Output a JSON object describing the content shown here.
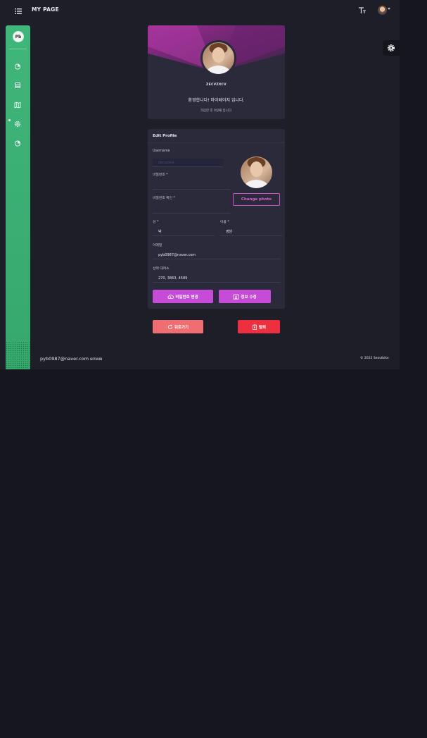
{
  "header": {
    "title": "MY PAGE"
  },
  "sidebar": {
    "logo_text": "Pb"
  },
  "profile": {
    "name": "ZECVZXCV",
    "welcome": "환영합니다! 마이페이지 입니다.",
    "joined": "가입한 후 0일째 입니다."
  },
  "edit_profile": {
    "title": "Edit Profile",
    "username_label": "Username",
    "username_placeholder": "zecvzxcv",
    "password_label": "비밀번호 *",
    "password_confirm_label": "비밀번호 확인 *",
    "change_photo": "Change photo",
    "last_name_label": "성 *",
    "last_name_value": "박",
    "first_name_label": "이름 *",
    "first_name_value": "영빈",
    "email_label": "이메일",
    "email_value": "pyb0987@naver.com",
    "station_label": "선택 대여소",
    "station_value": "270, 3863, 4589",
    "change_password_button": "비밀번호 변경",
    "update_info_button": "정보 수정"
  },
  "actions": {
    "back_button": "뒤로가기",
    "withdraw_button": "탈퇴"
  },
  "footer": {
    "email": "pyb0987@naver.com",
    "github": "GITHUB",
    "copyright": "© 2022 Seoulbike"
  },
  "colors": {
    "sidebar_green": "#3fb67a",
    "accent_magenta": "#c64bd6",
    "back_pink": "#f06e72",
    "withdraw_red": "#ee2f3f"
  }
}
